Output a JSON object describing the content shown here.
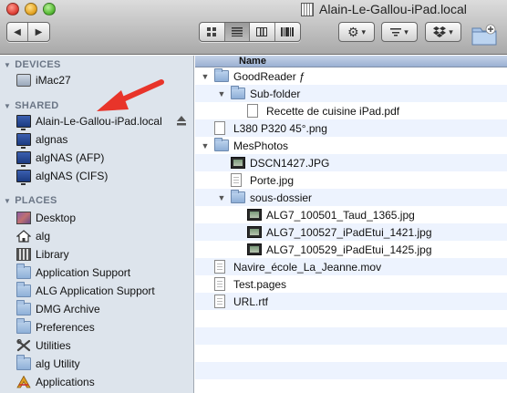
{
  "window": {
    "title": "Alain-Le-Gallou-iPad.local"
  },
  "toolbar": {
    "back_glyph": "◀",
    "forward_glyph": "▶",
    "view_modes": [
      "icon-view",
      "list-view",
      "column-view",
      "coverflow-view"
    ],
    "active_view": "list-view",
    "action_glyph": "⚙",
    "dropdown_glyph": "▾"
  },
  "sidebar": {
    "devices_header": "DEVICES",
    "devices": [
      {
        "label": "iMac27",
        "icon": "imac-icon"
      }
    ],
    "shared_header": "SHARED",
    "shared": [
      {
        "label": "Alain-Le-Gallou-iPad.local",
        "icon": "monitor-icon",
        "ejectable": true
      },
      {
        "label": "algnas",
        "icon": "monitor-icon"
      },
      {
        "label": "algNAS (AFP)",
        "icon": "monitor-icon"
      },
      {
        "label": "algNAS (CIFS)",
        "icon": "monitor-icon"
      }
    ],
    "places_header": "PLACES",
    "places": [
      {
        "label": "Desktop",
        "icon": "desktop-icon"
      },
      {
        "label": "alg",
        "icon": "home-icon"
      },
      {
        "label": "Library",
        "icon": "library-icon"
      },
      {
        "label": "Application Support",
        "icon": "folder-icon"
      },
      {
        "label": "ALG Application Support",
        "icon": "folder-icon"
      },
      {
        "label": "DMG Archive",
        "icon": "folder-icon"
      },
      {
        "label": "Preferences",
        "icon": "folder-icon"
      },
      {
        "label": "Utilities",
        "icon": "utilities-icon"
      },
      {
        "label": "alg Utility",
        "icon": "folder-icon"
      },
      {
        "label": "Applications",
        "icon": "applications-icon"
      }
    ]
  },
  "filelist": {
    "column_header": "Name",
    "rows": [
      {
        "name": "GoodReader ƒ",
        "level": 0,
        "type": "folder",
        "expanded": true
      },
      {
        "name": "Sub-folder",
        "level": 1,
        "type": "folder",
        "expanded": true
      },
      {
        "name": "Recette de cuisine iPad.pdf",
        "level": 2,
        "type": "pdf"
      },
      {
        "name": "L380 P320 45°.png",
        "level": 0,
        "type": "png"
      },
      {
        "name": "MesPhotos",
        "level": 0,
        "type": "folder",
        "expanded": true
      },
      {
        "name": "DSCN1427.JPG",
        "level": 1,
        "type": "jpg"
      },
      {
        "name": "Porte.jpg",
        "level": 1,
        "type": "doc"
      },
      {
        "name": "sous-dossier",
        "level": 1,
        "type": "folder",
        "expanded": true
      },
      {
        "name": "ALG7_100501_Taud_1365.jpg",
        "level": 2,
        "type": "jpg"
      },
      {
        "name": "ALG7_100527_iPadEtui_1421.jpg",
        "level": 2,
        "type": "jpg"
      },
      {
        "name": "ALG7_100529_iPadEtui_1425.jpg",
        "level": 2,
        "type": "jpg"
      },
      {
        "name": "Navire_école_La_Jeanne.mov",
        "level": 0,
        "type": "doc"
      },
      {
        "name": "Test.pages",
        "level": 0,
        "type": "doc"
      },
      {
        "name": "URL.rtf",
        "level": 0,
        "type": "doc"
      }
    ]
  },
  "colors": {
    "sidebar_bg": "#dde4ec",
    "row_alt": "#edf3fe",
    "arrow": "#e8342a"
  }
}
